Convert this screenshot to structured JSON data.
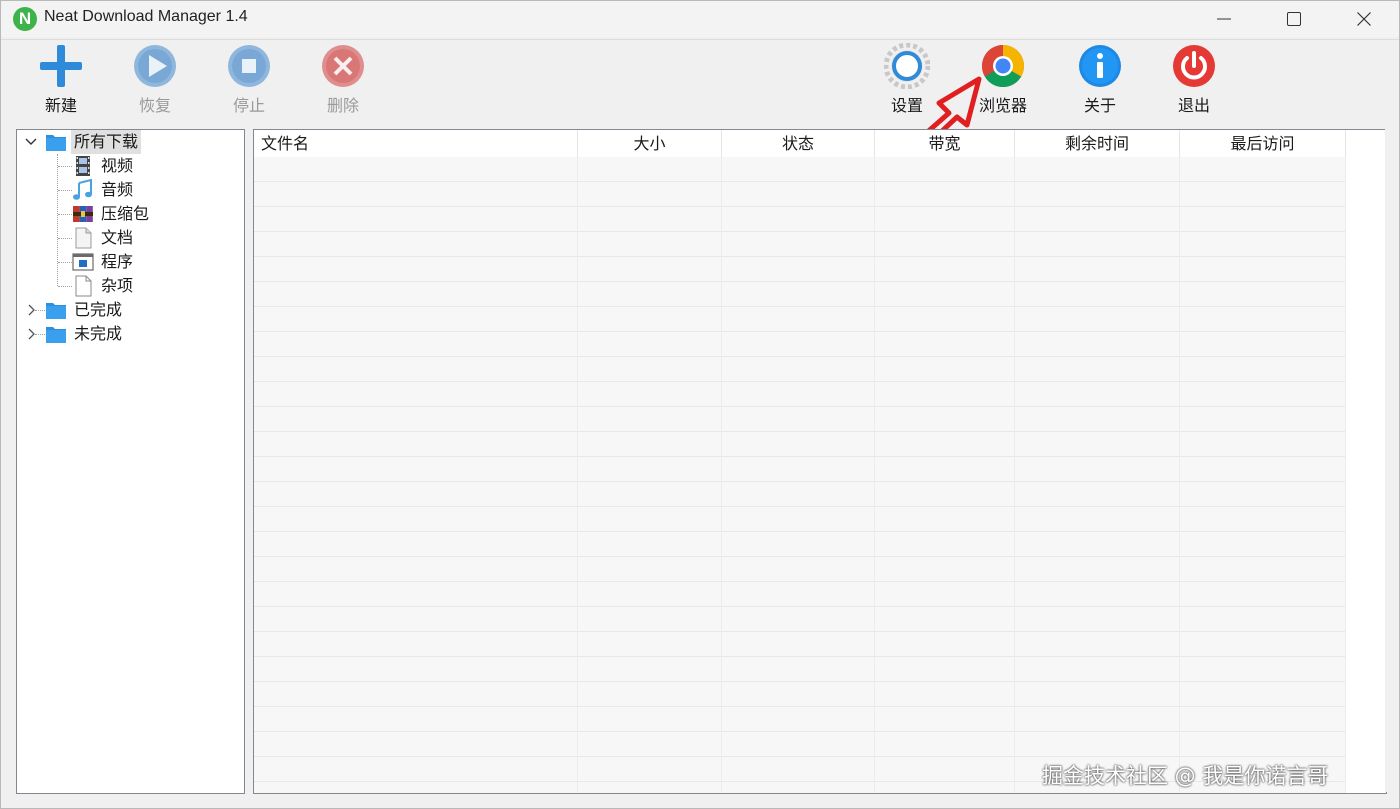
{
  "window": {
    "title": "Neat Download Manager 1.4",
    "app_icon_letter": "N"
  },
  "toolbar": {
    "new": "新建",
    "resume": "恢复",
    "stop": "停止",
    "delete": "删除",
    "settings": "设置",
    "browser": "浏览器",
    "about": "关于",
    "exit": "退出"
  },
  "tree": {
    "all_downloads": "所有下载",
    "categories": [
      "视频",
      "音频",
      "压缩包",
      "文档",
      "程序",
      "杂项"
    ],
    "completed": "已完成",
    "incomplete": "未完成"
  },
  "columns": [
    "文件名",
    "大小",
    "状态",
    "带宽",
    "剩余时间",
    "最后访问"
  ],
  "watermark": "掘金技术社区 @ 我是你诺言哥",
  "colors": {
    "accent_blue": "#2f8ad9",
    "annotation_red": "#e02020",
    "exit_red": "#e53935"
  }
}
